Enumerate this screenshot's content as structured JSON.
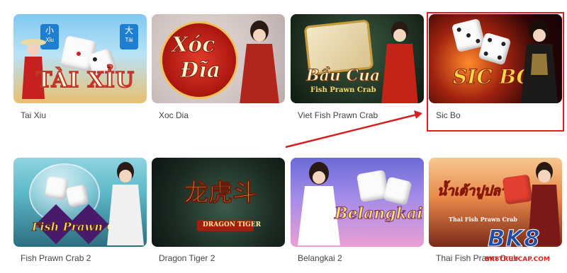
{
  "games": [
    {
      "label": "Tai Xiu",
      "art": "TÀI XỈU",
      "sign_left": "小",
      "sign_left_sub": "Xỉu",
      "sign_right": "大",
      "sign_right_sub": "Tài"
    },
    {
      "label": "Xoc Dia",
      "art_line1": "Xóc",
      "art_line2": "Đĩa"
    },
    {
      "label": "Viet Fish Prawn Crab",
      "art_line1": "Bầu Cua",
      "art_line2": "Fish Prawn Crab"
    },
    {
      "label": "Sic Bo",
      "art": "SIC BO"
    },
    {
      "label": "Fish Prawn Crab 2",
      "art": "Fish Prawn Crab"
    },
    {
      "label": "Dragon Tiger 2",
      "art": "龙虎斗",
      "art_sub": "DRAGON TIGER"
    },
    {
      "label": "Belangkai 2",
      "art": "Belangkai"
    },
    {
      "label": "Thai Fish Prawn Crab",
      "art": "น้ำเต้าปูปลา",
      "art_sub": "Thai Fish Prawn Crab"
    }
  ],
  "watermark": {
    "brand": "BK8",
    "site": "BK8TRUYCAP.COM"
  },
  "colors": {
    "highlight": "#e02020",
    "arrow": "#d81e1e",
    "label": "#444444"
  }
}
